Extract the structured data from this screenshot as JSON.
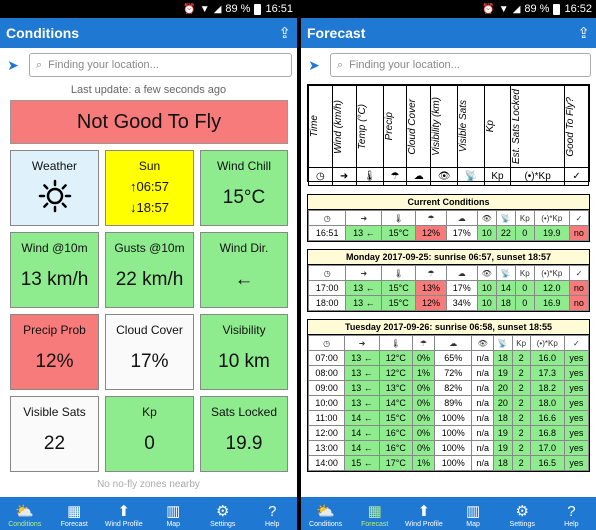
{
  "status_left": {
    "battery": "89 %",
    "time": "16:51"
  },
  "status_right": {
    "battery": "89 %",
    "time": "16:52"
  },
  "conditions": {
    "title": "Conditions",
    "location_placeholder": "Finding your location...",
    "last_update": "Last update: a few seconds ago",
    "verdict": "Not Good To Fly",
    "tiles": {
      "weather": {
        "label": "Weather"
      },
      "sun": {
        "label": "Sun",
        "rise": "↑06:57",
        "set": "↓18:57"
      },
      "wind_chill": {
        "label": "Wind Chill",
        "value": "15°C"
      },
      "wind": {
        "label": "Wind @10m",
        "value": "13 km/h"
      },
      "gusts": {
        "label": "Gusts @10m",
        "value": "22 km/h"
      },
      "wind_dir": {
        "label": "Wind Dir.",
        "value": "←"
      },
      "precip": {
        "label": "Precip Prob",
        "value": "12%"
      },
      "cloud": {
        "label": "Cloud Cover",
        "value": "17%"
      },
      "visibility": {
        "label": "Visibility",
        "value": "10 km"
      },
      "visible_sats": {
        "label": "Visible Sats",
        "value": "22"
      },
      "kp": {
        "label": "Kp",
        "value": "0"
      },
      "sats_locked": {
        "label": "Sats Locked",
        "value": "19.9"
      }
    },
    "no_fly": "No no-fly zones nearby"
  },
  "forecast": {
    "title": "Forecast",
    "location_placeholder": "Finding your location...",
    "columns": [
      "Time",
      "Wind (km/h)",
      "Temp (°C)",
      "Precip",
      "Cloud Cover",
      "Visibility (km)",
      "Visible Sats",
      "Kp",
      "Est. Sats Locked",
      "Good To Fly?"
    ],
    "column_icons": [
      "◷",
      "➜",
      "🌡",
      "☂",
      "☁",
      "👁",
      "📡",
      "Kp",
      "(•)*Kp",
      "✓"
    ],
    "current": {
      "title": "Current Conditions",
      "rows": [
        [
          "16:51",
          "13 ←",
          "15°C",
          "12%",
          "17%",
          "10",
          "22",
          "0",
          "19.9",
          "no"
        ]
      ]
    },
    "day1": {
      "title": "Monday 2017-09-25: sunrise 06:57, sunset 18:57",
      "rows": [
        [
          "17:00",
          "13 ←",
          "15°C",
          "13%",
          "17%",
          "10",
          "14",
          "0",
          "12.0",
          "no"
        ],
        [
          "18:00",
          "13 ←",
          "15°C",
          "12%",
          "34%",
          "10",
          "18",
          "0",
          "16.9",
          "no"
        ]
      ]
    },
    "day2": {
      "title": "Tuesday 2017-09-26: sunrise 06:58, sunset 18:55",
      "rows": [
        [
          "07:00",
          "13 ←",
          "12°C",
          "0%",
          "65%",
          "n/a",
          "18",
          "2",
          "16.0",
          "yes"
        ],
        [
          "08:00",
          "13 ←",
          "12°C",
          "1%",
          "72%",
          "n/a",
          "19",
          "2",
          "17.3",
          "yes"
        ],
        [
          "09:00",
          "13 ←",
          "13°C",
          "0%",
          "82%",
          "n/a",
          "20",
          "2",
          "18.2",
          "yes"
        ],
        [
          "10:00",
          "13 ←",
          "14°C",
          "0%",
          "89%",
          "n/a",
          "20",
          "2",
          "18.0",
          "yes"
        ],
        [
          "11:00",
          "14 ←",
          "15°C",
          "0%",
          "100%",
          "n/a",
          "18",
          "2",
          "16.6",
          "yes"
        ],
        [
          "12:00",
          "14 ←",
          "16°C",
          "0%",
          "100%",
          "n/a",
          "19",
          "2",
          "16.8",
          "yes"
        ],
        [
          "13:00",
          "14 ←",
          "16°C",
          "0%",
          "100%",
          "n/a",
          "19",
          "2",
          "17.0",
          "yes"
        ],
        [
          "14:00",
          "15 ←",
          "17°C",
          "1%",
          "100%",
          "n/a",
          "18",
          "2",
          "16.5",
          "yes"
        ]
      ]
    }
  },
  "nav": [
    {
      "label": "Conditions",
      "icon": "cloud-sun-icon"
    },
    {
      "label": "Forecast",
      "icon": "calendar-icon"
    },
    {
      "label": "Wind Profile",
      "icon": "arrow-up-icon"
    },
    {
      "label": "Map",
      "icon": "map-icon"
    },
    {
      "label": "Settings",
      "icon": "gear-icon"
    },
    {
      "label": "Help",
      "icon": "help-icon"
    }
  ],
  "colors": {
    "appbar": "#1f78d1",
    "good": "#8eec8e",
    "bad": "#f77b7b",
    "sun": "#ffff00",
    "nav_active": "#b6f083"
  }
}
